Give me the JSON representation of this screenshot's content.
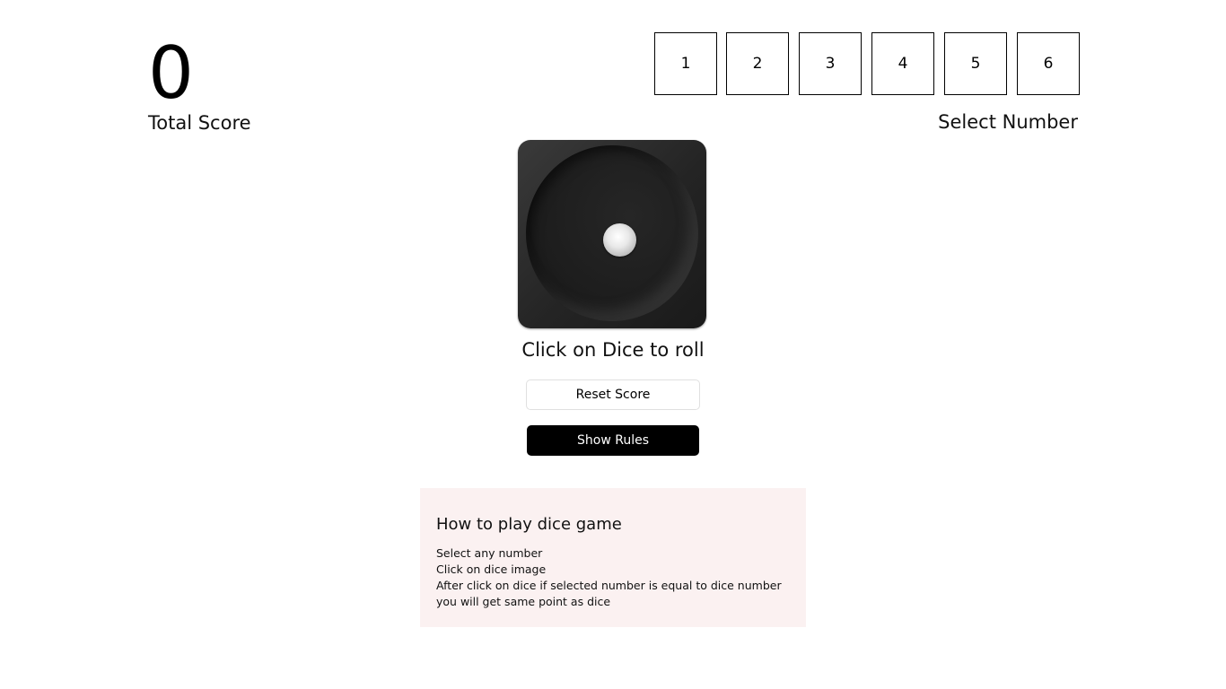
{
  "score": {
    "value": "0",
    "label": "Total Score"
  },
  "selector": {
    "numbers": [
      "1",
      "2",
      "3",
      "4",
      "5",
      "6"
    ],
    "label": "Select Number"
  },
  "dice": {
    "current_face": 1,
    "hint": "Click on Dice to roll"
  },
  "buttons": {
    "reset_label": "Reset Score",
    "rules_label": "Show Rules"
  },
  "rules": {
    "title": "How to play dice game",
    "lines": [
      "Select any number",
      "Click on dice image",
      "After click on dice if selected number is equal to dice number you will get same point as dice"
    ]
  },
  "colors": {
    "rules_panel_bg": "#fbf1f1",
    "primary_button_bg": "#000000",
    "dice_body": "#242424"
  }
}
